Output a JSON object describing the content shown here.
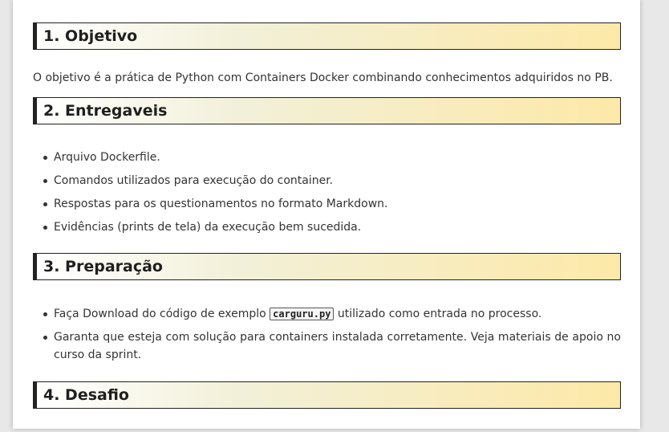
{
  "sections": [
    {
      "title": "1. Objetivo",
      "paragraph": "O objetivo é a prática de Python com Containers Docker combinando conhecimentos adquiridos no PB."
    },
    {
      "title": "2. Entregaveis",
      "items": [
        "Arquivo Dockerfile.",
        "Comandos utilizados para execução do container.",
        "Respostas para os questionamentos no formato Markdown.",
        "Evidências (prints de tela) da execução bem sucedida."
      ]
    },
    {
      "title": "3. Preparação",
      "item1_before": "Faça Download do código de exemplo ",
      "item1_code": "carguru.py",
      "item1_after": " utilizado como entrada no processo.",
      "item2": "Garanta que esteja com solução para containers instalada corretamente. Veja materiais de apoio no curso da sprint."
    },
    {
      "title": "4. Desafio"
    }
  ],
  "colors": {
    "heading_gradient_end": "#fde9a8",
    "heading_border": "#222222"
  }
}
